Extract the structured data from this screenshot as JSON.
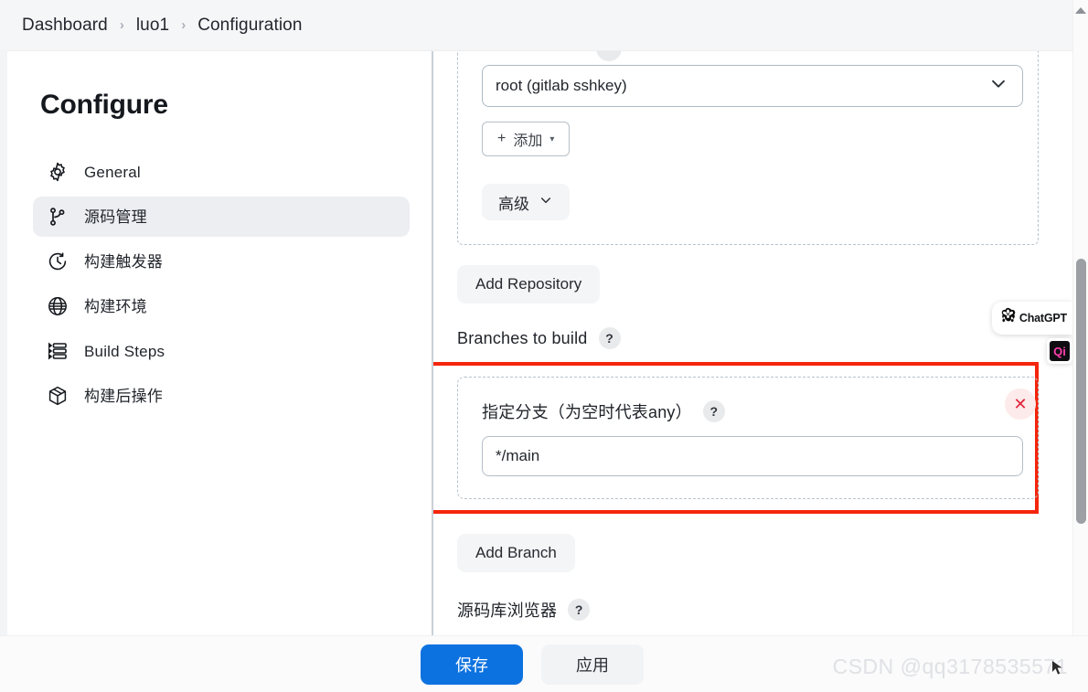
{
  "breadcrumb": {
    "items": [
      {
        "label": "Dashboard"
      },
      {
        "label": "luo1"
      },
      {
        "label": "Configuration"
      }
    ],
    "separator": "›"
  },
  "sidebar": {
    "title": "Configure",
    "items": [
      {
        "label": "General",
        "icon": "gear-icon",
        "active": false
      },
      {
        "label": "源码管理",
        "icon": "git-branch-icon",
        "active": true
      },
      {
        "label": "构建触发器",
        "icon": "clock-icon",
        "active": false
      },
      {
        "label": "构建环境",
        "icon": "globe-icon",
        "active": false
      },
      {
        "label": "Build Steps",
        "icon": "list-steps-icon",
        "active": false
      },
      {
        "label": "构建后操作",
        "icon": "package-icon",
        "active": false
      }
    ]
  },
  "main": {
    "credentials_select": {
      "value": "root (gitlab sshkey)",
      "caret": "chevron-down-icon"
    },
    "add_credential_button": {
      "plus": "+",
      "label": "添加",
      "caret": "▾"
    },
    "advanced_button": {
      "label": "高级",
      "caret": "chevron-down-icon"
    },
    "add_repository_button": "Add Repository",
    "branches_label": "Branches to build",
    "help_badge": "?",
    "branch_entry": {
      "label": "指定分支（为空时代表any）",
      "help": "?",
      "value": "*/main",
      "placeholder": "",
      "delete_label": "✕"
    },
    "add_branch_button": "Add Branch",
    "repo_browser_label": "源码库浏览器",
    "highlight_color": "#f4250b"
  },
  "action_bar": {
    "save_label": "保存",
    "apply_label": "应用",
    "primary_color": "#0c72e0"
  },
  "widgets": {
    "chatgpt": {
      "label": "ChatGPT",
      "icon": "openai-flower-icon"
    },
    "qi": {
      "label": "Qi",
      "icon": "qi-logo-icon"
    }
  },
  "watermark": "CSDN @qq3178535571"
}
